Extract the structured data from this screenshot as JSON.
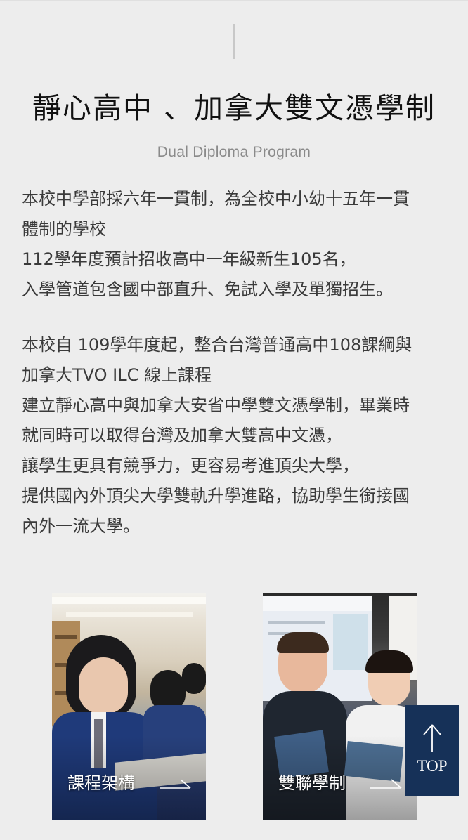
{
  "section": {
    "title": "靜心高中 、加拿大雙文憑學制",
    "subtitle": "Dual Diploma Program"
  },
  "paragraph1": {
    "lines": [
      "本校中學部採六年一貫制，為全校中小幼十五年一貫",
      "體制的學校",
      "112學年度預計招收高中一年級新生105名，",
      "入學管道包含國中部直升、免試入學及單獨招生。"
    ]
  },
  "paragraph2": {
    "lines": [
      "本校自 109學年度起，整合台灣普通高中108課綱與",
      "加拿大TVO ILC 線上課程",
      "建立靜心高中與加拿大安省中學雙文憑學制，畢業時",
      "就同時可以取得台灣及加拿大雙高中文憑，",
      "讓學生更具有競爭力，更容易考進頂尖大學，",
      "提供國內外頂尖大學雙軌升學進路，協助學生銜接國",
      "內外一流大學。"
    ]
  },
  "cards": [
    {
      "label": "課程架構",
      "icon": "arrow-right-icon"
    },
    {
      "label": "雙聯學制",
      "icon": "arrow-right-icon"
    }
  ],
  "top_button": {
    "label": "TOP",
    "icon": "arrow-up-icon",
    "background": "#163158"
  },
  "colors": {
    "page_background": "#ededed",
    "title": "#111111",
    "subtitle": "#8a8a8a",
    "body_text": "#3a3a3a"
  }
}
